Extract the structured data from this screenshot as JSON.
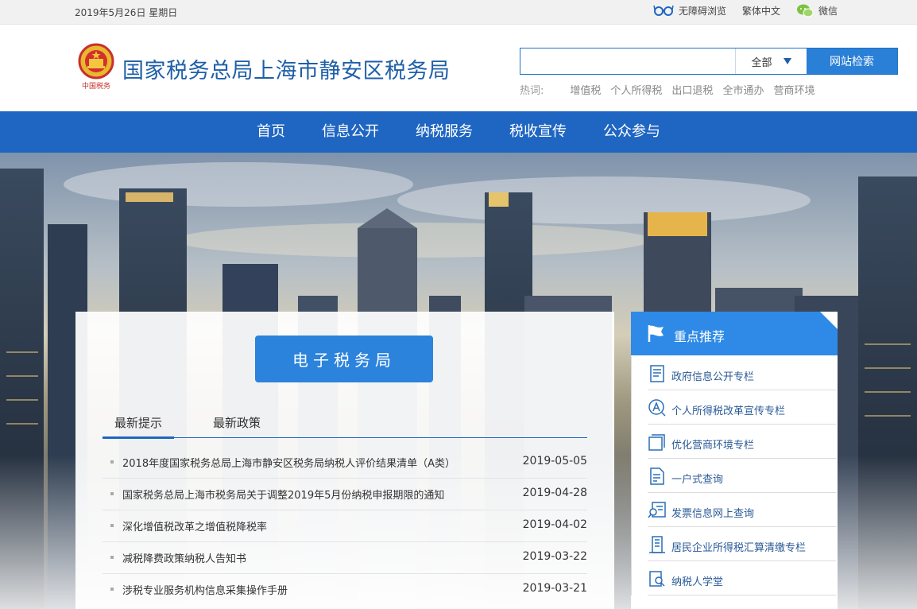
{
  "topbar": {
    "date": "2019年5月26日 星期日",
    "accessibility_label": "无障碍浏览",
    "traditional_label": "繁体中文",
    "wechat_label": "微信"
  },
  "header": {
    "emblem_text": "中国税务",
    "site_title": "国家税务总局上海市静安区税务局"
  },
  "search": {
    "placeholder": "",
    "value": "",
    "scope": "全部",
    "button_label": "网站检索",
    "hotwords_label": "热词:",
    "hotwords": [
      "增值税",
      "个人所得税",
      "出口退税",
      "全市通办",
      "营商环境"
    ]
  },
  "nav": {
    "items": [
      "首页",
      "信息公开",
      "纳税服务",
      "税收宣传",
      "公众参与"
    ]
  },
  "main": {
    "etax_label": "电子税务局",
    "tabs": [
      "最新提示",
      "最新政策"
    ],
    "news": [
      {
        "title": "2018年度国家税务总局上海市静安区税务局纳税人评价结果清单（A类）",
        "date": "2019-05-05"
      },
      {
        "title": "国家税务总局上海市税务局关于调整2019年5月份纳税申报期限的通知",
        "date": "2019-04-28"
      },
      {
        "title": "深化增值税改革之增值税降税率",
        "date": "2019-04-02"
      },
      {
        "title": "减税降费政策纳税人告知书",
        "date": "2019-03-22"
      },
      {
        "title": "涉税专业服务机构信息采集操作手册",
        "date": "2019-03-21"
      }
    ]
  },
  "recommend": {
    "title": "重点推荐",
    "items": [
      {
        "label": "政府信息公开专栏",
        "icon": "document-list-icon"
      },
      {
        "label": "个人所得税改革宣传专栏",
        "icon": "tax-a-circle-icon"
      },
      {
        "label": "优化营商环境专栏",
        "icon": "stacked-pages-icon"
      },
      {
        "label": "一户式查询",
        "icon": "file-query-icon"
      },
      {
        "label": "发票信息网上查询",
        "icon": "invoice-search-icon"
      },
      {
        "label": "居民企业所得税汇算清缴专栏",
        "icon": "enterprise-doc-icon"
      },
      {
        "label": "纳税人学堂",
        "icon": "learning-search-icon"
      }
    ]
  },
  "colors": {
    "brand_blue": "#1f66c2",
    "accent_blue": "#2b83dc",
    "title_blue": "#1f5fa8"
  }
}
